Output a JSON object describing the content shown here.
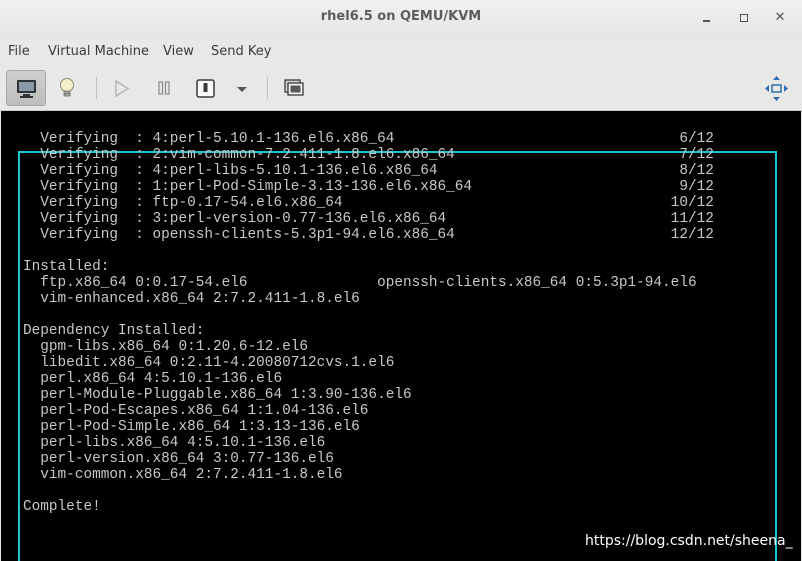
{
  "window": {
    "title": "rhel6.5 on QEMU/KVM"
  },
  "menubar": {
    "items": [
      "File",
      "Virtual Machine",
      "View",
      "Send Key"
    ]
  },
  "toolbar": {
    "buttons": [
      {
        "name": "console-view",
        "icon": "monitor-icon",
        "active": true
      },
      {
        "name": "details-view",
        "icon": "lightbulb-icon",
        "active": false
      },
      {
        "name": "run",
        "icon": "play-icon",
        "active": false
      },
      {
        "name": "pause",
        "icon": "pause-icon",
        "active": false
      },
      {
        "name": "shutdown",
        "icon": "power-icon",
        "active": false
      },
      {
        "name": "shutdown-menu",
        "icon": "chevron-down-icon",
        "active": false
      },
      {
        "name": "snapshots",
        "icon": "snapshots-icon",
        "active": false
      },
      {
        "name": "fullscreen",
        "icon": "fullscreen-icon",
        "active": false
      }
    ]
  },
  "console": {
    "lines": [
      "  Verifying  : 4:perl-5.10.1-136.el6.x86_64                                 6/12",
      "  Verifying  : 2:vim-common-7.2.411-1.8.el6.x86_64                          7/12",
      "  Verifying  : 4:perl-libs-5.10.1-136.el6.x86_64                            8/12",
      "  Verifying  : 1:perl-Pod-Simple-3.13-136.el6.x86_64                        9/12",
      "  Verifying  : ftp-0.17-54.el6.x86_64                                      10/12",
      "  Verifying  : 3:perl-version-0.77-136.el6.x86_64                          11/12",
      "  Verifying  : openssh-clients-5.3p1-94.el6.x86_64                         12/12",
      "",
      "Installed:",
      "  ftp.x86_64 0:0.17-54.el6               openssh-clients.x86_64 0:5.3p1-94.el6",
      "  vim-enhanced.x86_64 2:7.2.411-1.8.el6",
      "",
      "Dependency Installed:",
      "  gpm-libs.x86_64 0:1.20.6-12.el6",
      "  libedit.x86_64 0:2.11-4.20080712cvs.1.el6",
      "  perl.x86_64 4:5.10.1-136.el6",
      "  perl-Module-Pluggable.x86_64 1:3.90-136.el6",
      "  perl-Pod-Escapes.x86_64 1:1.04-136.el6",
      "  perl-Pod-Simple.x86_64 1:3.13-136.el6",
      "  perl-libs.x86_64 4:5.10.1-136.el6",
      "  perl-version.x86_64 3:0.77-136.el6",
      "  vim-common.x86_64 2:7.2.411-1.8.el6",
      "",
      "Complete!"
    ]
  },
  "watermark": {
    "text": "https://blog.csdn.net/sheena_"
  },
  "colors": {
    "console_text": "#c8c8c8",
    "console_frame": "#1ec5d0",
    "console_bg": "#000000",
    "chrome_bg": "#e8e8e7"
  }
}
